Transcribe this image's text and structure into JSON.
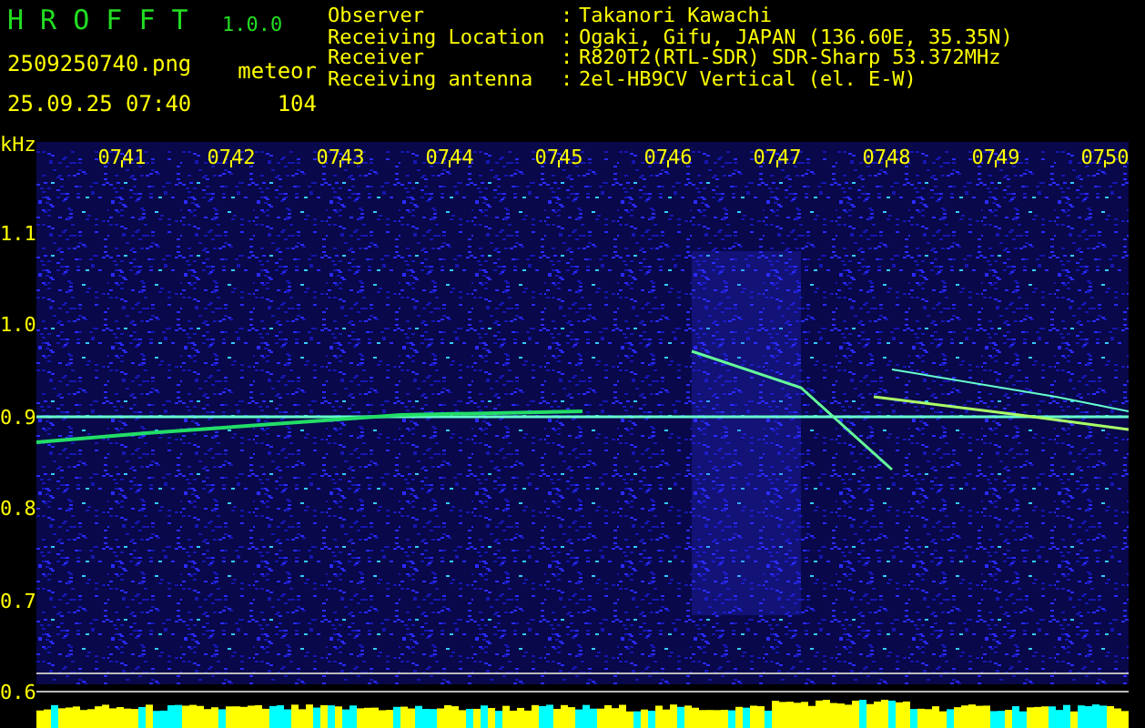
{
  "app": {
    "name": "H R O F F T",
    "version": "1.0.0"
  },
  "file": {
    "name": "2509250740.png",
    "datetime": "25.09.25 07:40"
  },
  "detection": {
    "label": "meteor",
    "count": "104"
  },
  "info": [
    {
      "label": "Observer",
      "separator": ":",
      "value": "Takanori Kawachi"
    },
    {
      "label": "Receiving Location",
      "separator": ":",
      "value": "Ogaki, Gifu, JAPAN (136.60E, 35.35N)"
    },
    {
      "label": "Receiver",
      "separator": ":",
      "value": "R820T2(RTL-SDR) SDR-Sharp 53.372MHz"
    },
    {
      "label": "Receiving antenna",
      "separator": ":",
      "value": "2el-HB9CV Vertical (el. E-W)"
    }
  ],
  "spectrogram": {
    "unit": "kHz",
    "y_labels": [
      "1.1",
      "1.0",
      "0.9",
      "0.8",
      "0.7",
      "0.6"
    ],
    "time_labels": [
      "0741",
      "0742",
      "0743",
      "0744",
      "0745",
      "0746",
      "0747",
      "0748",
      "0749",
      "0750"
    ]
  }
}
